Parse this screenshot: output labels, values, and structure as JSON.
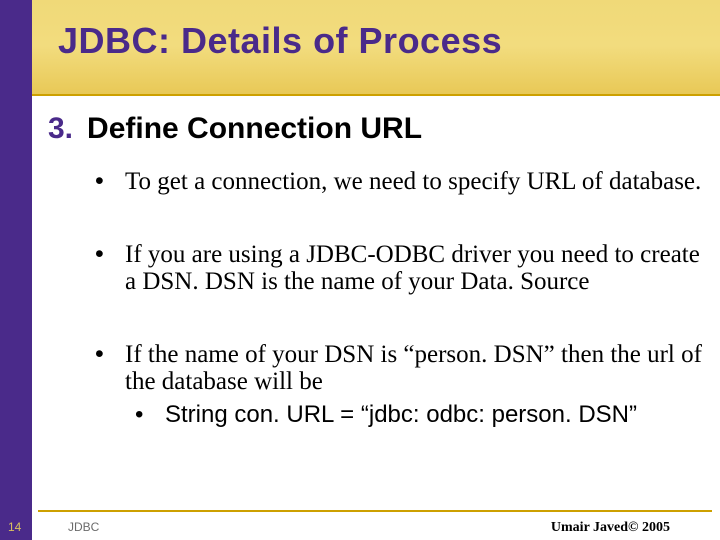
{
  "slide": {
    "title": "JDBC: Details of Process",
    "section_number": "3.",
    "section_heading": "Define Connection URL",
    "bullets": [
      {
        "text": "To get a connection, we need to specify URL of database."
      },
      {
        "text": "If you are using a JDBC-ODBC driver you need to create a DSN. DSN is the name of your Data. Source"
      },
      {
        "text": "If the name of your DSN is “person. DSN” then the url of the database will be",
        "sub": "String con. URL = “jdbc: odbc: person. DSN”"
      }
    ]
  },
  "footer": {
    "page": "14",
    "label": "JDBC",
    "copyright": "Umair Javed© 2005"
  }
}
